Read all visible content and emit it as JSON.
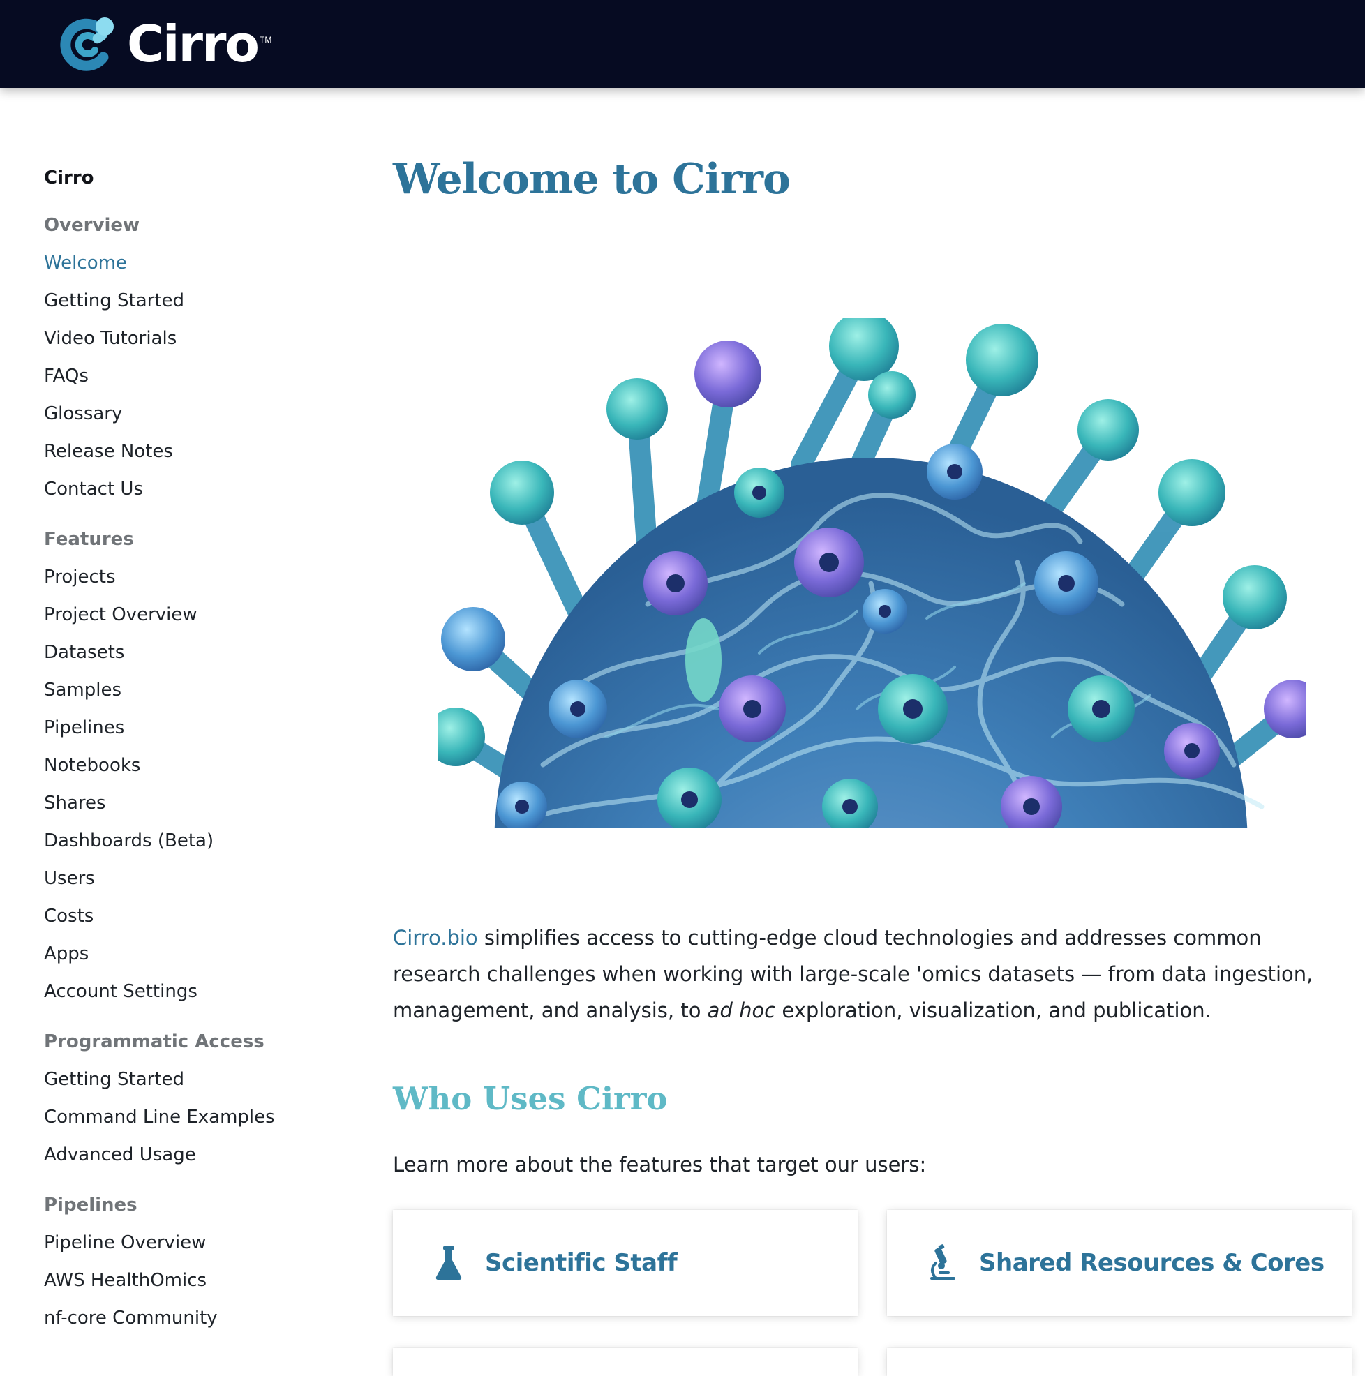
{
  "header": {
    "brand_name": "Cirro",
    "brand_tm": "TM",
    "brand_colors": {
      "bar": "#060b22",
      "mark": "#3da5c9"
    }
  },
  "sidebar": {
    "title": "Cirro",
    "sections": [
      {
        "heading": "Overview",
        "items": [
          "Welcome",
          "Getting Started",
          "Video Tutorials",
          "FAQs",
          "Glossary",
          "Release Notes",
          "Contact Us"
        ],
        "active": "Welcome"
      },
      {
        "heading": "Features",
        "items": [
          "Projects",
          "Project Overview",
          "Datasets",
          "Samples",
          "Pipelines",
          "Notebooks",
          "Shares",
          "Dashboards (Beta)",
          "Users",
          "Costs",
          "Apps",
          "Account Settings"
        ]
      },
      {
        "heading": "Programmatic Access",
        "items": [
          "Getting Started",
          "Command Line Examples",
          "Advanced Usage"
        ]
      },
      {
        "heading": "Pipelines",
        "items": [
          "Pipeline Overview",
          "AWS HealthOmics",
          "nf-core Community"
        ]
      }
    ]
  },
  "main": {
    "title": "Welcome to Cirro",
    "intro": {
      "link_text": "Cirro.bio",
      "text_1": " simplifies access to cutting-edge cloud technologies and addresses common research challenges when working with large-scale 'omics datasets — from data ingestion, management, and analysis, to ",
      "emphasis": "ad hoc",
      "text_2": " exploration, visualization, and publication."
    },
    "who_title": "Who Uses Cirro",
    "lead": "Learn more about the features that target our users:",
    "cards": [
      {
        "label": "Scientific Staff",
        "icon": "flask-icon"
      },
      {
        "label": "Shared Resources & Cores",
        "icon": "microscope-icon"
      }
    ]
  },
  "colors": {
    "accent": "#2d7399",
    "subheading": "#5fb9c6",
    "section_heading": "#707478",
    "text": "#1e2329"
  }
}
